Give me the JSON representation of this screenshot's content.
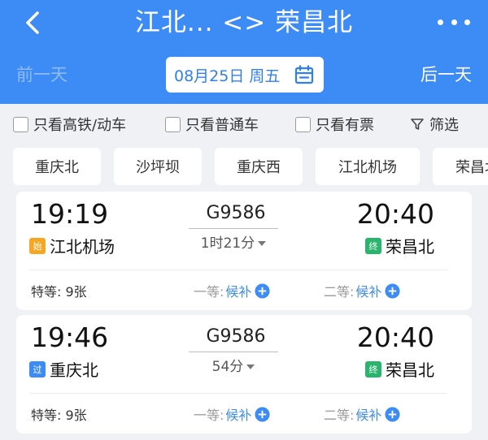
{
  "header": {
    "title": "江北... <> 荣昌北",
    "prev_day": "前一天",
    "next_day": "后一天",
    "date": "08月25日 周五"
  },
  "filters": {
    "high_speed": "只看高铁/动车",
    "normal": "只看普通车",
    "available": "只看有票",
    "filter": "筛选"
  },
  "stations": [
    "重庆北",
    "沙坪坝",
    "重庆西",
    "江北机场",
    "荣昌北"
  ],
  "trains": [
    {
      "dep_time": "19:19",
      "arr_time": "20:40",
      "train_no": "G9586",
      "duration": "1时21分",
      "dep_badge": "始",
      "dep_station": "江北机场",
      "arr_badge": "终",
      "arr_station": "荣昌北",
      "seat_premium": "特等: 9张",
      "seat_first_label": "一等:",
      "seat_first_value": "候补",
      "seat_second_label": "二等:",
      "seat_second_value": "候补"
    },
    {
      "dep_time": "19:46",
      "arr_time": "20:40",
      "train_no": "G9586",
      "duration": "54分",
      "dep_badge": "过",
      "dep_station": "重庆北",
      "arr_badge": "终",
      "arr_station": "荣昌北",
      "seat_premium": "特等: 9张",
      "seat_first_label": "一等:",
      "seat_first_value": "候补",
      "seat_second_label": "二等:",
      "seat_second_value": "候补"
    }
  ],
  "colors": {
    "primary": "#3d8bf5",
    "start_badge": "#f5a623",
    "end_badge": "#29b56c"
  }
}
